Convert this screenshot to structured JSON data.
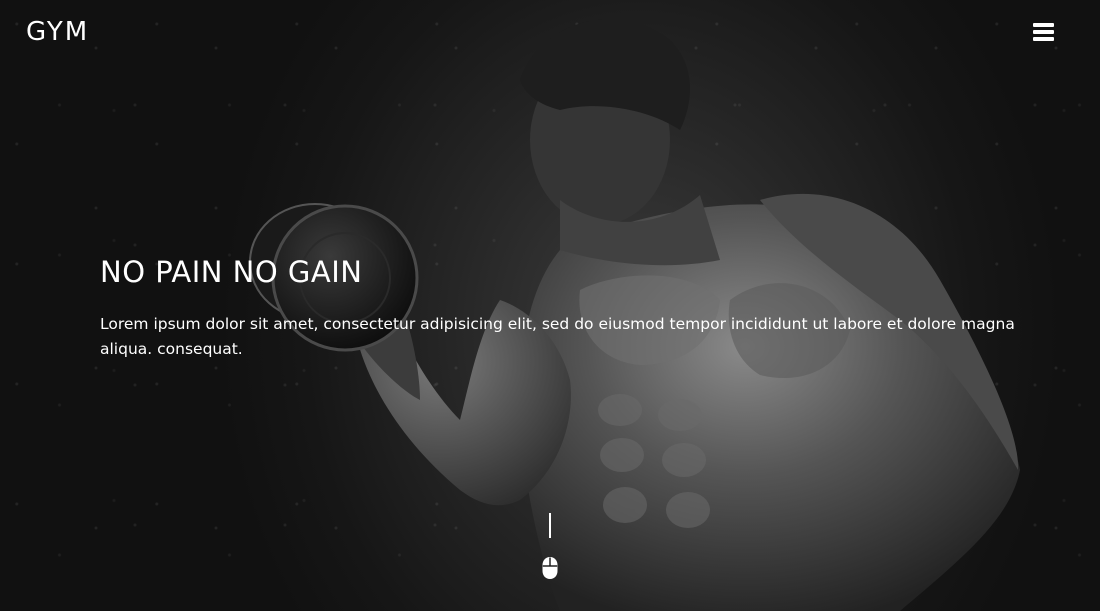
{
  "header": {
    "logo": "GYM",
    "menu_icon": "hamburger-menu-icon"
  },
  "hero": {
    "title": "NO PAIN NO GAIN",
    "text": "Lorem ipsum dolor sit amet, consectetur adipisicing elit, sed do eiusmod tempor incididunt ut labore et dolore magna aliqua. consequat.",
    "background_image": "muscular man lifting dumbbell, black and white photo",
    "scroll_icon": "mouse-scroll-icon"
  },
  "colors": {
    "text": "#ffffff",
    "background": "#141414"
  }
}
